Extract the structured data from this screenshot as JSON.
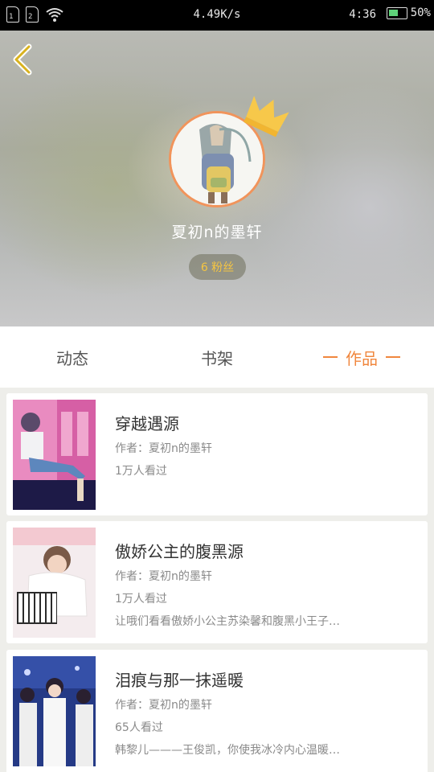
{
  "status_bar": {
    "sim1": "1",
    "sim2": "2",
    "speed": "4.49K/s",
    "time": "4:36",
    "battery": "50%"
  },
  "profile": {
    "username": "夏初n的墨轩",
    "fans": "6 粉丝"
  },
  "tabs": [
    "动态",
    "书架",
    "作品"
  ],
  "active_tab": "作品",
  "works": [
    {
      "title": "穿越遇源",
      "author": "作者：夏初n的墨轩",
      "views": "1万人看过",
      "desc": ""
    },
    {
      "title": "傲娇公主的腹黑源",
      "author": "作者：夏初n的墨轩",
      "views": "1万人看过",
      "desc": "让哦们看看傲娇小公主苏染馨和腹黑小王子…"
    },
    {
      "title": "泪痕与那一抹遥暖",
      "author": "作者：夏初n的墨轩",
      "views": "65人看过",
      "desc": "韩黎儿———王俊凯，你使我冰冷内心温暖…"
    }
  ],
  "colors": {
    "accent": "#f0873e",
    "fans_text": "#f5c542",
    "avatar_border": "#f1945b"
  },
  "icons": [
    "back-arrow-icon",
    "crown-icon",
    "wifi-icon",
    "battery-icon"
  ]
}
